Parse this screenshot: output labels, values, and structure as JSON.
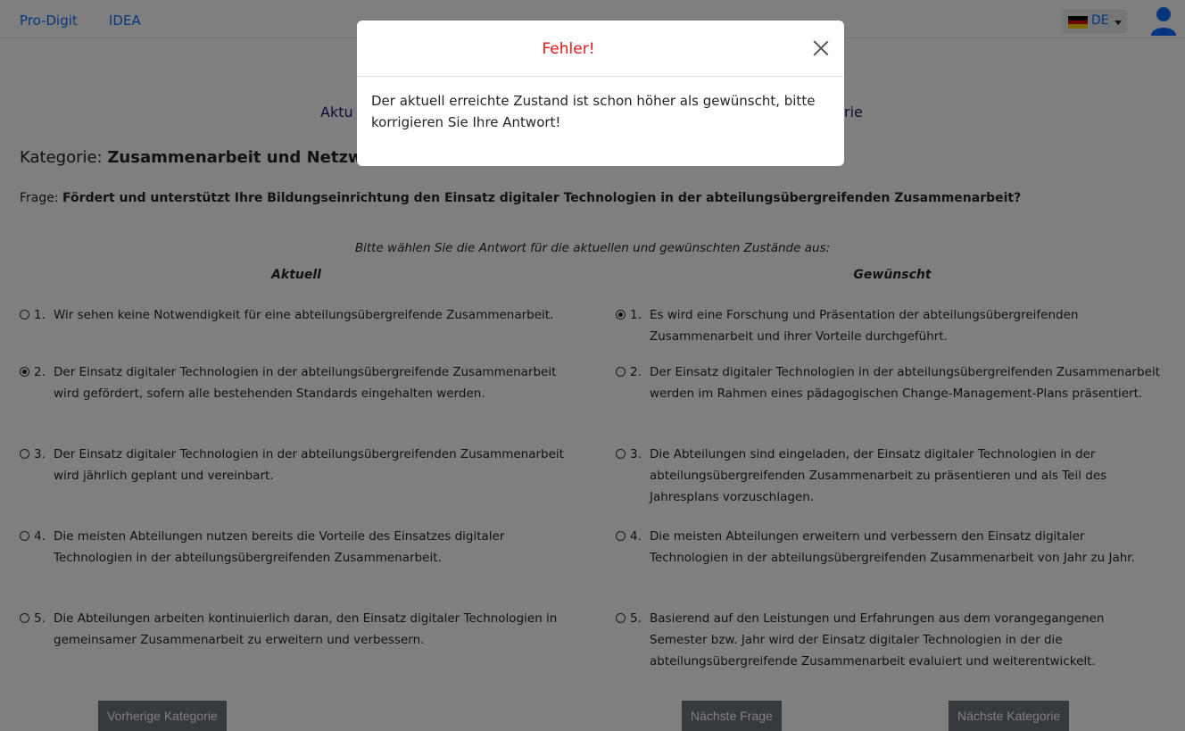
{
  "nav": {
    "link1": "Pro-Digit",
    "link2": "IDEA",
    "lang": "DE",
    "flag_colors": [
      "#000000",
      "#dd0000",
      "#ffce00"
    ],
    "avatar_icon": "user-avatar-icon",
    "accent": "#0d6efd"
  },
  "main": {
    "subtitle_left": "Aktu",
    "subtitle_right": "rie",
    "kategorie_label": "Kategorie:",
    "kategorie_value": "Zusammenarbeit und Netzwer",
    "frage_label": "Frage:",
    "frage_value": "Fördert und unterstützt Ihre Bildungseinrichtung den Einsatz digitaler Technologien in der abteilungsübergreifenden Zusammenarbeit?",
    "instruction": "Bitte wählen Sie die Antwort für die aktuellen und gewünschten Zustände aus:",
    "aktuell_heading": "Aktuell",
    "gewuenscht_heading": "Gewünscht",
    "aktuell_options": [
      {
        "num": "1.",
        "text": "Wir sehen keine Notwendigkeit für eine abteilungsübergreifende Zusammenarbeit.",
        "checked": false
      },
      {
        "num": "2.",
        "text": "Der Einsatz digitaler Technologien in der abteilungsübergreifende Zusammenarbeit wird gefördert, sofern alle bestehenden Standards eingehalten werden.",
        "checked": true
      },
      {
        "num": "3.",
        "text": "Der Einsatz digitaler Technologien in der abteilungsübergreifenden Zusammenarbeit wird jährlich geplant und vereinbart.",
        "checked": false
      },
      {
        "num": "4.",
        "text": "Die meisten Abteilungen nutzen bereits die Vorteile des Einsatzes digitaler Technologien in der abteilungsübergreifenden Zusammenarbeit.",
        "checked": false
      },
      {
        "num": "5.",
        "text": "Die Abteilungen arbeiten kontinuierlich daran, den Einsatz digitaler Technologien in gemeinsamer Zusammenarbeit zu erweitern und verbessern.",
        "checked": false
      }
    ],
    "gewuenscht_options": [
      {
        "num": "1.",
        "text": "Es wird eine Forschung und Präsentation der abteilungsübergreifenden Zusammenarbeit und ihrer Vorteile durchgeführt.",
        "checked": true
      },
      {
        "num": "2.",
        "text": "Der Einsatz digitaler Technologien in der abteilungsübergreifenden Zusammenarbeit werden im Rahmen eines pädagogischen Change-Management-Plans präsentiert.",
        "checked": false
      },
      {
        "num": "3.",
        "text": "Die Abteilungen sind eingeladen, der Einsatz digitaler Technologien in der abteilungsübergreifenden Zusammenarbeit zu präsentieren und als Teil des Jahresplans vorzuschlagen.",
        "checked": false
      },
      {
        "num": "4.",
        "text": "Die meisten Abteilungen erweitern und verbessern den Einsatz digitaler Technologien in der abteilungsübergreifenden Zusammenarbeit von Jahr zu Jahr.",
        "checked": false
      },
      {
        "num": "5.",
        "text": "Basierend auf den Leistungen und Erfahrungen aus dem vorangegangenen Semester bzw. Jahr wird der Einsatz digitaler Technologien in der die abteilungsübergreifende Zusammenarbeit evaluiert und weiterentwickelt.",
        "checked": false
      }
    ],
    "buttons": {
      "prev_category": "Vorherige Kategorie",
      "next_question": "Nächste Frage",
      "next_category": "Nächste Kategorie"
    }
  },
  "modal": {
    "title": "Fehler!",
    "title_color": "#e11818",
    "close_icon": "close-icon",
    "body": "Der aktuell erreichte Zustand ist schon höher als gewünscht, bitte korrigieren Sie Ihre Antwort!"
  }
}
